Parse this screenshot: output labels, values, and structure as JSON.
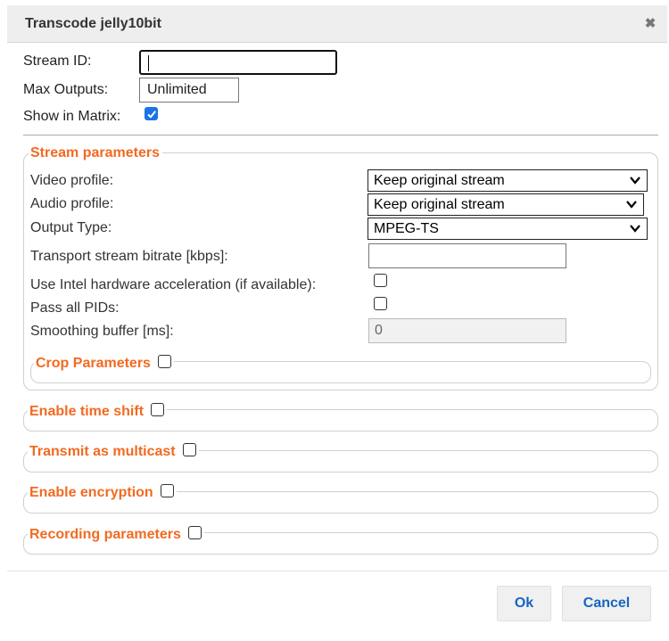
{
  "dialog": {
    "title": "Transcode jelly10bit",
    "close_symbol": "✖"
  },
  "general": {
    "stream_id_label": "Stream ID:",
    "stream_id_value": "",
    "max_outputs_label": "Max Outputs:",
    "max_outputs_value": "Unlimited",
    "show_in_matrix_label": "Show in Matrix:",
    "show_in_matrix_checked": true
  },
  "stream_parameters": {
    "legend": "Stream parameters",
    "video_profile_label": "Video profile:",
    "video_profile_value": "Keep original stream",
    "audio_profile_label": "Audio profile:",
    "audio_profile_value": "Keep original stream",
    "output_type_label": "Output Type:",
    "output_type_value": "MPEG-TS",
    "ts_bitrate_label": "Transport stream bitrate [kbps]:",
    "ts_bitrate_value": "",
    "intel_hw_label": "Use Intel hardware acceleration (if available):",
    "pass_pids_label": "Pass all PIDs:",
    "smoothing_label": "Smoothing buffer [ms]:",
    "smoothing_value": "0",
    "crop_legend": "Crop Parameters"
  },
  "sections": {
    "time_shift": "Enable time shift",
    "multicast": "Transmit as multicast",
    "encryption": "Enable encryption",
    "recording": "Recording parameters"
  },
  "buttons": {
    "ok": "Ok",
    "cancel": "Cancel"
  },
  "colors": {
    "legend_orange": "#f26a21",
    "button_blue": "#1565c0",
    "checkbox_blue": "#1a73e8"
  }
}
